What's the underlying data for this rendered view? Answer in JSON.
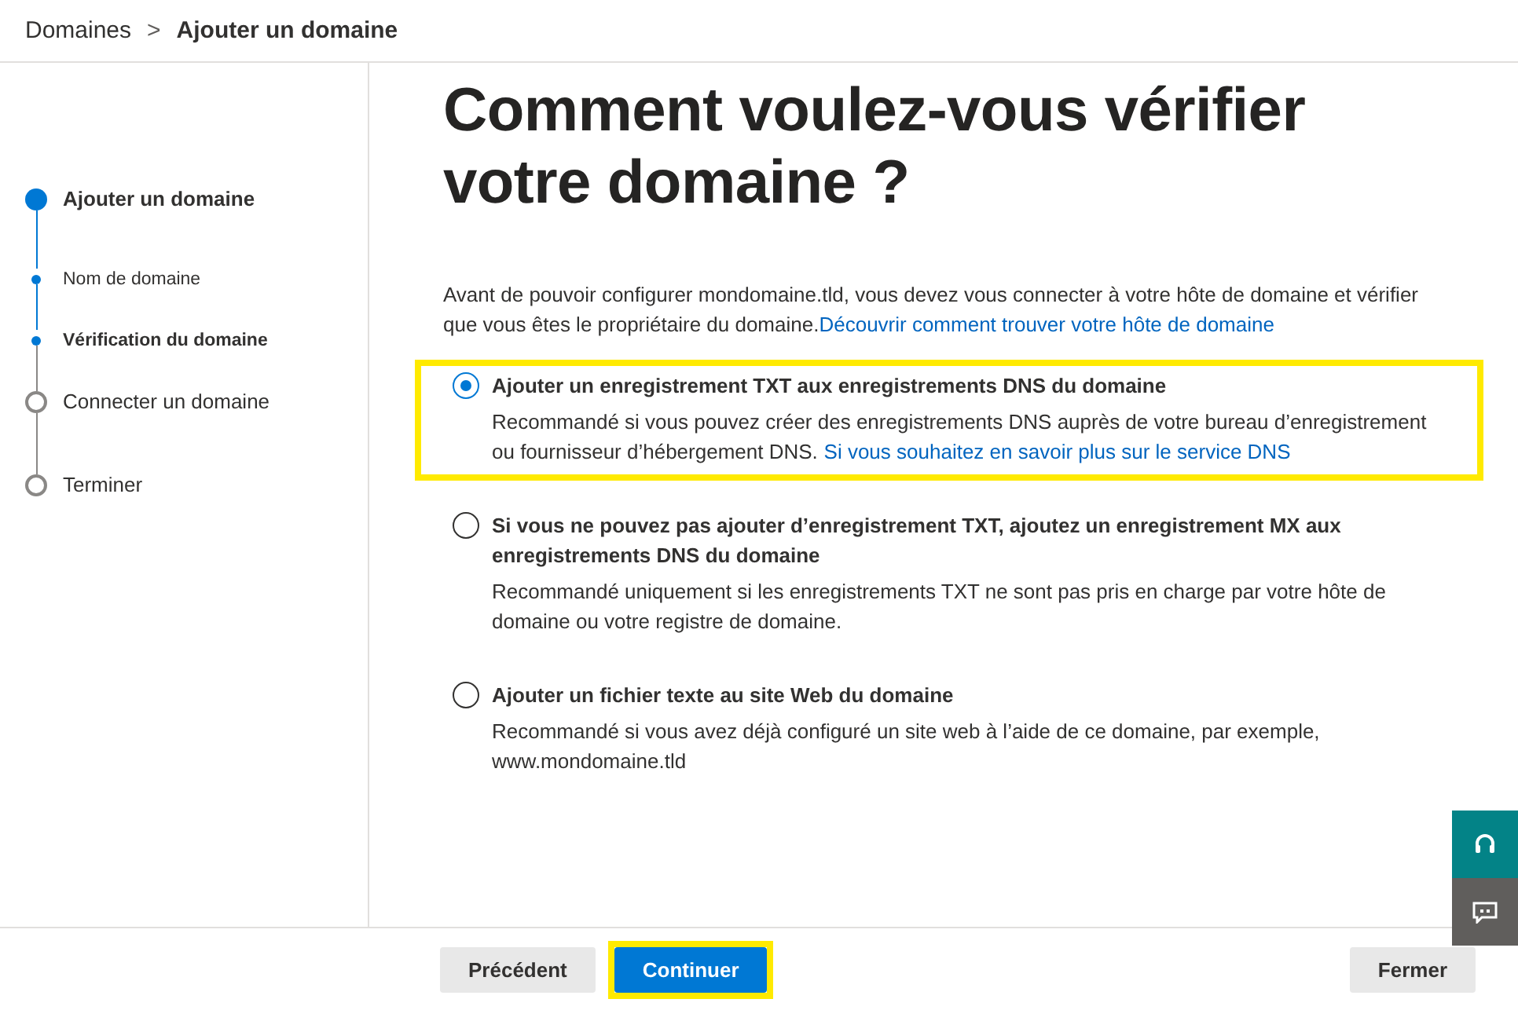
{
  "breadcrumb": {
    "parent": "Domaines",
    "separator": ">",
    "current": "Ajouter un domaine"
  },
  "steps": [
    {
      "label": "Ajouter un domaine",
      "active": true,
      "children": [
        {
          "label": "Nom de domaine",
          "selected": false
        },
        {
          "label": "Vérification du domaine",
          "selected": true
        }
      ]
    },
    {
      "label": "Connecter un domaine",
      "active": false
    },
    {
      "label": "Terminer",
      "active": false
    }
  ],
  "title": "Comment voulez-vous vérifier votre domaine ?",
  "intro": {
    "text": "Avant de pouvoir configurer mondomaine.tld, vous devez vous connecter à votre hôte de domaine et vérifier que vous êtes le propriétaire du domaine.",
    "link": "Découvrir comment trouver votre hôte de domaine"
  },
  "options": [
    {
      "label": "Ajouter un enregistrement TXT aux enregistrements DNS du domaine",
      "description": "Recommandé si vous pouvez créer des enregistrements DNS auprès de votre bureau d’enregistrement ou fournisseur d’hébergement DNS.",
      "link": "Si vous souhaitez en savoir plus sur le service DNS",
      "selected": true,
      "highlighted": true
    },
    {
      "label": "Si vous ne pouvez pas ajouter d’enregistrement TXT, ajoutez un enregistrement MX aux enregistrements DNS du domaine",
      "description": "Recommandé uniquement si les enregistrements TXT ne sont pas pris en charge par votre hôte de domaine ou votre registre de domaine.",
      "selected": false,
      "highlighted": false
    },
    {
      "label": "Ajouter un fichier texte au site Web du domaine",
      "description": "Recommandé si vous avez déjà configuré un site web à l’aide de ce domaine, par exemple, www.mondomaine.tld",
      "selected": false,
      "highlighted": false
    }
  ],
  "footer": {
    "buttons": [
      {
        "label": "Précédent",
        "kind": "secondary",
        "highlighted": false
      },
      {
        "label": "Continuer",
        "kind": "primary",
        "highlighted": true
      }
    ],
    "close": {
      "label": "Fermer"
    }
  }
}
